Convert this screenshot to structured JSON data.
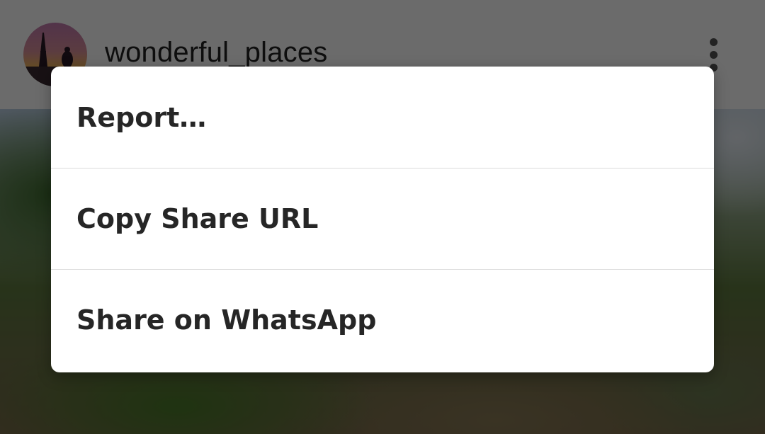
{
  "post": {
    "username": "wonderful_places",
    "avatar_icon": "avatar-eiffel-tower",
    "more_icon": "more-vertical-icon"
  },
  "dialog": {
    "items": [
      {
        "label": "Report…"
      },
      {
        "label": "Copy Share URL"
      },
      {
        "label": "Share on WhatsApp"
      }
    ]
  },
  "colors": {
    "scrim": "#000000",
    "dialog_bg": "#ffffff",
    "text": "#262626",
    "divider": "#dcdcdc"
  }
}
